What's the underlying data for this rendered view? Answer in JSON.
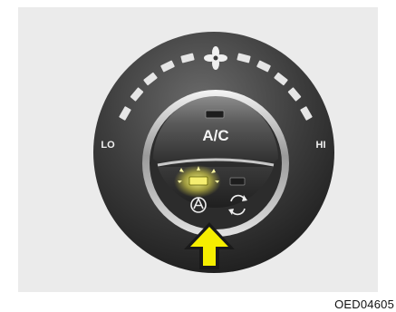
{
  "knob": {
    "ac_label": "A/C",
    "lo_label": "LO",
    "hi_label": "HI",
    "ac_indicator": "on",
    "fan_icon": "fan-icon",
    "auto_icon": "auto-mode-icon",
    "recirc_icon": "recirculation-icon"
  },
  "pointer": {
    "icon": "arrow-up-icon",
    "color": "#f5ee00"
  },
  "image_code": "OED04605"
}
